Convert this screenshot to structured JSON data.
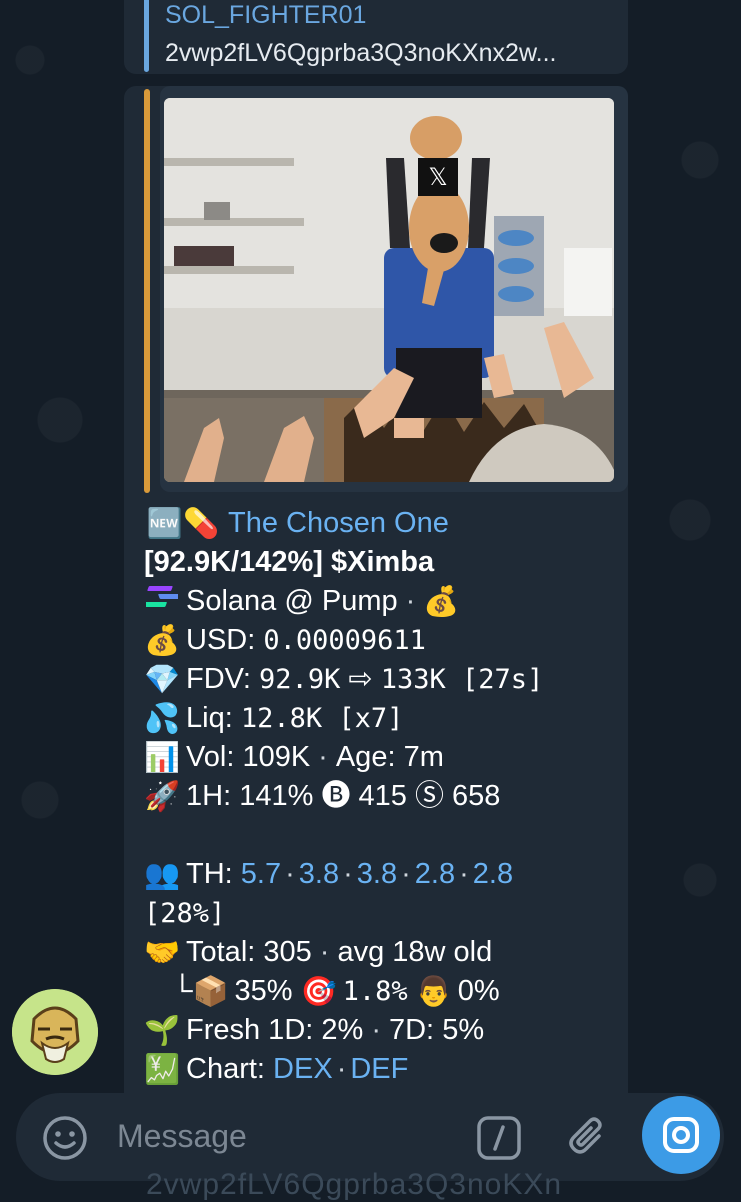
{
  "reply": {
    "author": "SOL_FIGHTER01",
    "text": "2vwp2fLV6Qgprba3Q3noKXnx2w..."
  },
  "message": {
    "title_emoji": "🆕💊",
    "title": "The Chosen One",
    "summary": "[92.9K/142%] $Ximba",
    "network_emoji": "🟰",
    "network": "Solana @ Pump",
    "network_dot": "·",
    "network_tail_emoji": "💰",
    "usd_emoji": "💰",
    "usd_label": "USD:",
    "usd_value": "0.00009611",
    "fdv_emoji": "💎",
    "fdv_label": "FDV:",
    "fdv_value": "92.9K",
    "fdv_arrow": "⇨",
    "fdv_target": "133K [27s]",
    "liq_emoji": "💦",
    "liq_label": "Liq:",
    "liq_value": "12.8K [x7]",
    "vol_emoji": "📊",
    "vol_label": "Vol:",
    "vol_value": "109K",
    "vol_dot": "·",
    "age_label": "Age:",
    "age_value": "7m",
    "h1_emoji": "🚀",
    "h1_label": "1H:",
    "h1_value": "141%",
    "buys_icon": "🅑",
    "buys_value": "415",
    "sells_icon": "Ⓢ",
    "sells_value": "658",
    "th_emoji": "👥",
    "th_label": "TH:",
    "th_values": [
      "5.7",
      "3.8",
      "3.8",
      "2.8",
      "2.8"
    ],
    "th_dot": "·",
    "th_percent": "[28%]",
    "total_emoji": "🤝",
    "total_label": "Total:",
    "total_value": "305",
    "total_dot": "·",
    "avg_text": "avg 18w old",
    "branch": "└",
    "box_emoji": "📦",
    "box_value": "35%",
    "target_emoji": "🎯",
    "target_value": "1.8%",
    "dev_emoji": "👨",
    "dev_value": "0%",
    "fresh_emoji": "🌱",
    "fresh_label": "Fresh 1D:",
    "fresh_1d": "2%",
    "fresh_dot": "·",
    "fresh_7d_label": "7D:",
    "fresh_7d": "5%",
    "chart_emoji": "💹",
    "chart_label": "Chart:",
    "chart_links": [
      "DEX",
      "DEF"
    ],
    "chart_dot": "·"
  },
  "preview": {
    "badge_letter": "𝕏"
  },
  "input": {
    "placeholder": "Message"
  },
  "ghost_text": "2vwp2fLV6Qgprba3Q3noKXn",
  "colors": {
    "link": "#6ab2f2",
    "bubble": "#1f2a36",
    "background": "#141d27",
    "accent": "#3c9be6",
    "preview_bar": "#d99a3a"
  }
}
